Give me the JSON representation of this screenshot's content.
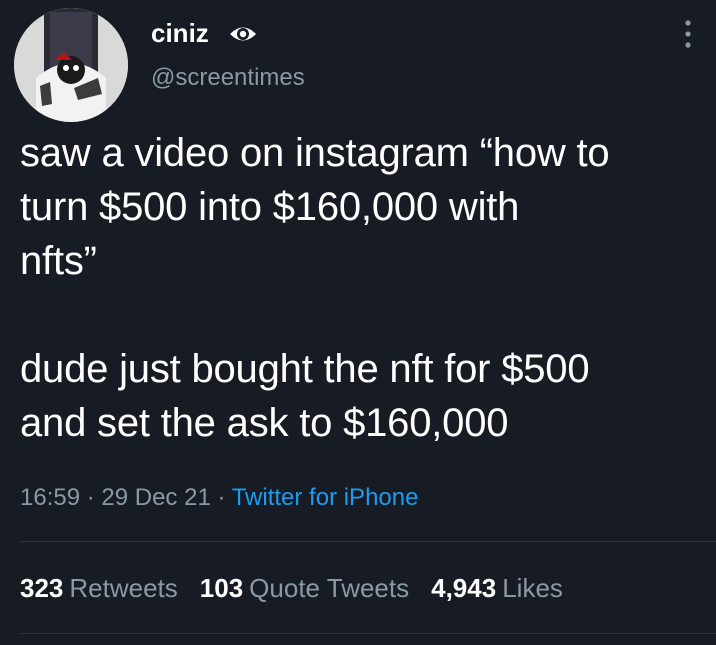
{
  "author": {
    "display_name": "ciniz",
    "handle": "@screentimes",
    "badge_icon": "eye-icon",
    "avatar_icon": "avatar-image"
  },
  "tweet": {
    "text": "saw a video on instagram “how to\nturn $500 into $160,000 with\nnfts”\n\ndude just bought the nft for $500\nand set the ask to $160,000"
  },
  "meta": {
    "time": "16:59",
    "separator": " · ",
    "date": "29 Dec 21",
    "source": "Twitter for iPhone"
  },
  "stats": {
    "retweets_count": "323",
    "retweets_label": "Retweets",
    "quotes_count": "103",
    "quotes_label": "Quote Tweets",
    "likes_count": "4,943",
    "likes_label": "Likes"
  },
  "colors": {
    "background": "#171c24",
    "text": "#ffffff",
    "secondary": "#8b98a5",
    "link": "#1d9bf0"
  }
}
